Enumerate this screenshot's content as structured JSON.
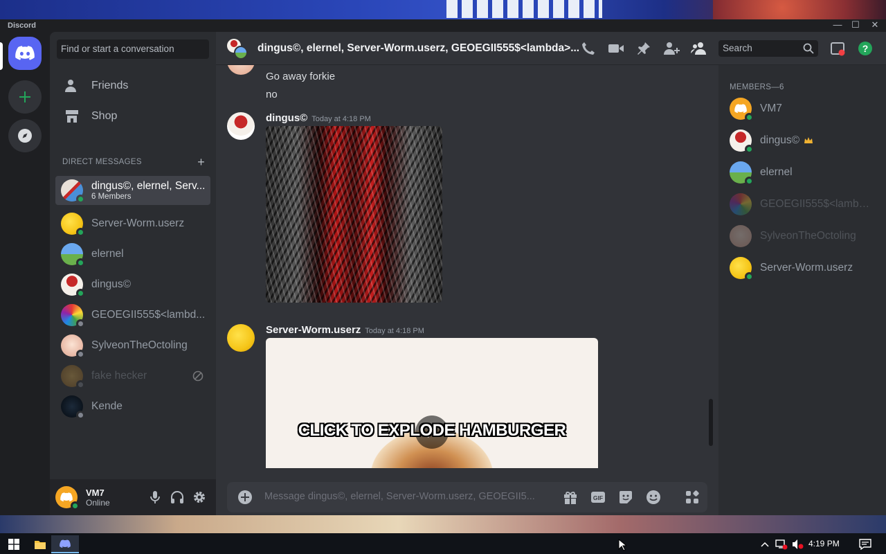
{
  "app": {
    "brand": "Discord"
  },
  "window_controls": {
    "minimize": "—",
    "maximize": "☐",
    "close": "✕"
  },
  "sidebar": {
    "search_placeholder": "Find or start a conversation",
    "nav": [
      {
        "label": "Friends",
        "icon": "friends-icon"
      },
      {
        "label": "Shop",
        "icon": "shop-icon"
      }
    ],
    "dm_header": "DIRECT MESSAGES",
    "dms": [
      {
        "name": "dingus©, elernel, Serv...",
        "sub": "6 Members",
        "status": "online",
        "color": "#c62828",
        "active": true
      },
      {
        "name": "Server-Worm.userz",
        "status": "online",
        "color": "#f5c518"
      },
      {
        "name": "elernel",
        "status": "online",
        "color": "#4a8fd8"
      },
      {
        "name": "dingus©",
        "status": "online",
        "color": "#e8e0d8"
      },
      {
        "name": "GEOEGII555$<lambd...",
        "status": "offline",
        "color": "#7b4cc4"
      },
      {
        "name": "SylveonTheOctoling",
        "status": "offline",
        "color": "#f0d8c8"
      },
      {
        "name": "fake hecker",
        "status": "offline",
        "color": "#b8862a",
        "blocked": true
      },
      {
        "name": "Kende",
        "status": "offline",
        "color": "#0a1420"
      }
    ],
    "user": {
      "name": "VM7",
      "status": "Online"
    }
  },
  "chat": {
    "title": "dingus©, elernel, Server-Worm.userz, GEOEGII555$<lambda>...",
    "search_placeholder": "Search",
    "messages": {
      "prev_line1": "Go away forkie",
      "prev_line2": "no",
      "m1_author": "dingus©",
      "m1_time": "Today at 4:18 PM",
      "m2_author": "Server-Worm.userz",
      "m2_time": "Today at 4:18 PM",
      "m2_caption": "CLICK TO EXPLODE HAMBURGER"
    },
    "composer_placeholder": "Message dingus©, elernel, Server-Worm.userz, GEOEGII5..."
  },
  "members": {
    "header": "MEMBERS—6",
    "list": [
      {
        "name": "VM7",
        "status": "online",
        "color": "#f5a623"
      },
      {
        "name": "dingus©",
        "status": "online",
        "color": "#e8e0d8",
        "owner": true
      },
      {
        "name": "elernel",
        "status": "online",
        "color": "#4a8fd8"
      },
      {
        "name": "GEOEGII555$<lambd...",
        "status": "offline",
        "color": "#7b4cc4"
      },
      {
        "name": "SylveonTheOctoling",
        "status": "offline",
        "color": "#f0d8c8"
      },
      {
        "name": "Server-Worm.userz",
        "status": "online",
        "color": "#f5c518"
      }
    ]
  },
  "taskbar": {
    "time": "4:19 PM"
  }
}
